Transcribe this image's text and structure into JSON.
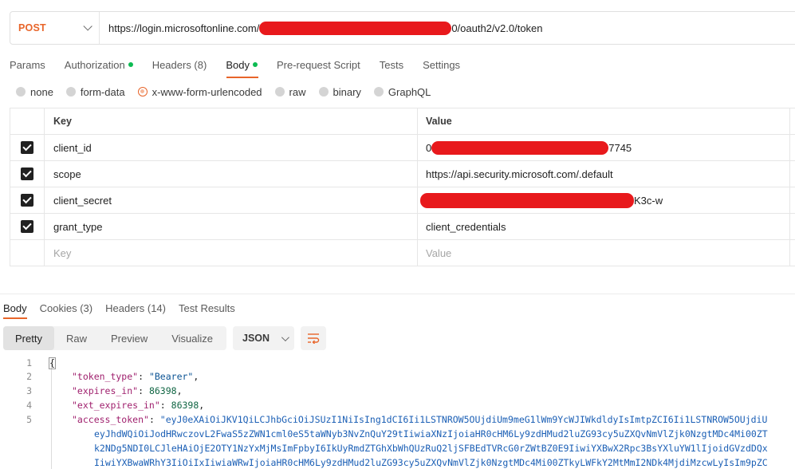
{
  "request": {
    "method": "POST",
    "url_prefix": "https://login.microsoftonline.com/",
    "url_suffix": "0/oauth2/v2.0/token"
  },
  "request_tabs": [
    {
      "label": "Params",
      "dot": false
    },
    {
      "label": "Authorization",
      "dot": true
    },
    {
      "label": "Headers (8)",
      "dot": false
    },
    {
      "label": "Body",
      "dot": true,
      "active": true
    },
    {
      "label": "Pre-request Script",
      "dot": false
    },
    {
      "label": "Tests",
      "dot": false
    },
    {
      "label": "Settings",
      "dot": false
    }
  ],
  "body_types": [
    {
      "label": "none",
      "selected": false
    },
    {
      "label": "form-data",
      "selected": false
    },
    {
      "label": "x-www-form-urlencoded",
      "selected": true
    },
    {
      "label": "raw",
      "selected": false
    },
    {
      "label": "binary",
      "selected": false
    },
    {
      "label": "GraphQL",
      "selected": false
    }
  ],
  "params_table": {
    "headers": {
      "key": "Key",
      "value": "Value"
    },
    "rows": [
      {
        "checked": true,
        "key": "client_id",
        "value_prefix": "0",
        "value_suffix": "7745",
        "redacted": true
      },
      {
        "checked": true,
        "key": "scope",
        "value": "https://api.security.microsoft.com/.default",
        "redacted": false
      },
      {
        "checked": true,
        "key": "client_secret",
        "value_prefix": "",
        "value_suffix": "K3c-w",
        "redacted": true
      },
      {
        "checked": true,
        "key": "grant_type",
        "value": "client_credentials",
        "redacted": false
      }
    ],
    "placeholder": {
      "key": "Key",
      "value": "Value"
    }
  },
  "response_tabs": [
    {
      "label": "Body",
      "active": true
    },
    {
      "label": "Cookies (3)",
      "active": false
    },
    {
      "label": "Headers (14)",
      "active": false
    },
    {
      "label": "Test Results",
      "active": false
    }
  ],
  "view_modes": [
    "Pretty",
    "Raw",
    "Preview",
    "Visualize"
  ],
  "active_view": "Pretty",
  "format": "JSON",
  "colors": {
    "accent": "#e8652a",
    "redaction": "#e8191c",
    "dot": "#0cbb52"
  },
  "icons": {
    "wrap": "wrap-lines-icon",
    "chevron": "chevron-down-icon"
  },
  "code": {
    "line_numbers": [
      "1",
      "2",
      "3",
      "4",
      "5"
    ],
    "open_brace": "{",
    "token_type_key": "\"token_type\"",
    "token_type_val": "\"Bearer\"",
    "expires_in_key": "\"expires_in\"",
    "expires_in_val": "86398",
    "ext_expires_in_key": "\"ext_expires_in\"",
    "ext_expires_in_val": "86398",
    "access_token_key": "\"access_token\"",
    "token_lines": [
      "\"eyJ0eXAiOiJKV1QiLCJhbGciOiJSUzI1NiIsIng1dCI6Ii1LSTNROW5OUjdiUm9meG1lWm9YcWJIWkdldyIsImtpZCI6Ii1LSTNROW5OUjdiU",
      "eyJhdWQiOiJodHRwczovL2FwaS5zZWN1cml0eS5taWNyb3NvZnQuY29tIiwiaXNzIjoiaHR0cHM6Ly9zdHMud2luZG93cy5uZXQvNmVlZjk0NzgtMDc4Mi00ZT",
      "k2NDg5NDI0LCJleHAiOjE2OTY1NzYxMjMsImFpbyI6IkUyRmdZTGhXbWhQUzRuQ2ljSFBEdTVRcG0rZWtBZ0E9IiwiYXBwX2Rpc3BsYXluYW1lIjoidGVzdDQx",
      "IiwiYXBwaWRhY3IiOiIxIiwiaWRwIjoiaHR0cHM6Ly9zdHMud2luZG93cy5uZXQvNmVlZjk0NzgtMDc4Mi00ZTkyLWFkY2MtMmI2NDk4MjdiMzcwLyIsIm9pZC"
    ]
  }
}
